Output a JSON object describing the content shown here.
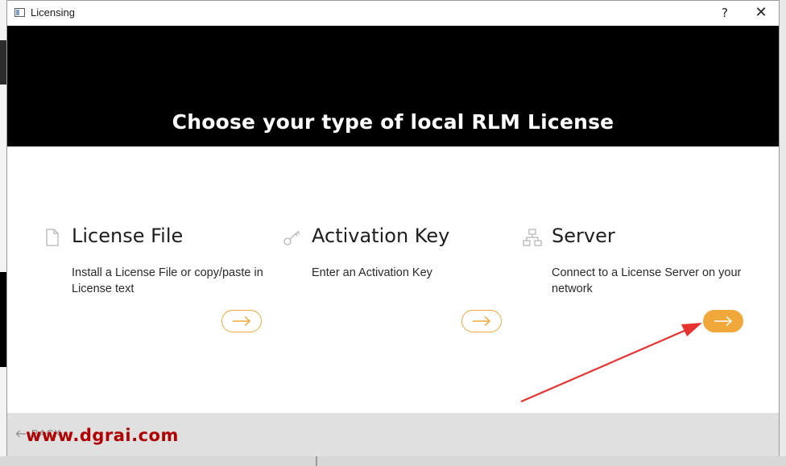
{
  "window": {
    "title": "Licensing",
    "help_glyph": "?",
    "close_glyph": "✕"
  },
  "banner": {
    "title": "Choose your type of local RLM License"
  },
  "options": [
    {
      "icon": "document-icon",
      "title": "License File",
      "description": "Install a License File or copy/paste in License text"
    },
    {
      "icon": "key-icon",
      "title": "Activation Key",
      "description": "Enter an Activation Key"
    },
    {
      "icon": "network-icon",
      "title": "Server",
      "description": "Connect to a License Server on your network",
      "highlighted": true
    }
  ],
  "footer": {
    "back_label": "BACK",
    "watermark": "www.dgrai.com"
  },
  "colors": {
    "accent": "#f0a83a",
    "banner_bg": "#000000",
    "annotation_arrow": "#e8322f",
    "watermark": "#b00000"
  }
}
